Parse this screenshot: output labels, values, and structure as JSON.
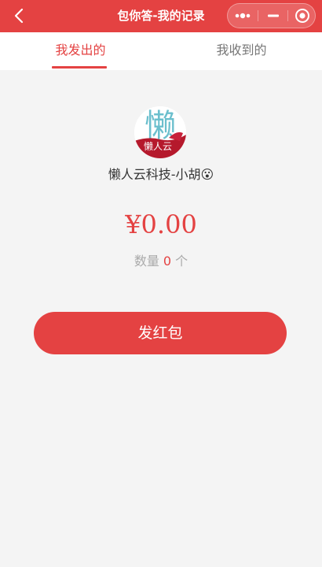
{
  "nav": {
    "title": "包你答-我的记录",
    "back_icon": "chevron-left-icon",
    "more_icon": "more-dots-icon",
    "minimize_icon": "minimize-icon",
    "close_icon": "target-close-icon"
  },
  "tabs": [
    {
      "label": "我发出的",
      "active": true
    },
    {
      "label": "我收到的",
      "active": false
    }
  ],
  "profile": {
    "avatar_glyph": "懒",
    "avatar_subtext": "懒人云",
    "username": "懒人云科技-小胡😮"
  },
  "summary": {
    "amount": "¥0.00",
    "count_label": "数量",
    "count_value": "0",
    "count_unit": "个"
  },
  "actions": {
    "send_label": "发红包"
  },
  "colors": {
    "accent": "#e44242",
    "background": "#f4f4f4",
    "muted_text": "#aaaaaa"
  }
}
